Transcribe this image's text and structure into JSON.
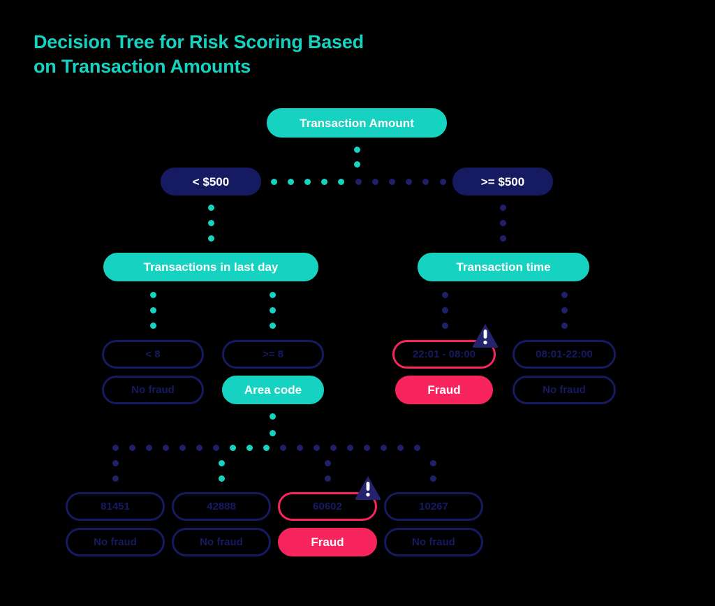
{
  "title": {
    "line1": "Decision Tree for Risk Scoring Based",
    "line2": "on Transaction Amounts"
  },
  "colors": {
    "background": "#000000",
    "teal": "#16d2c0",
    "navy": "#161a60",
    "pink": "#f8245e",
    "white": "#ffffff",
    "dot_navy": "#20206a"
  },
  "nodes": {
    "root": "Transaction Amount",
    "branch_low": "< $500",
    "branch_high": ">= $500",
    "left_feature": "Transactions in last day",
    "right_feature": "Transaction time",
    "left_count_low": "< 8",
    "left_count_high": ">= 8",
    "left_leaf_no_fraud": "No fraud",
    "area_code": "Area code",
    "time_night": "22:01 - 08:00",
    "time_day": "08:01-22:00",
    "time_night_leaf": "Fraud",
    "time_day_leaf": "No fraud",
    "zip_1": "81451",
    "zip_2": "42888",
    "zip_3": "60602",
    "zip_4": "10267",
    "zip_1_leaf": "No fraud",
    "zip_2_leaf": "No fraud",
    "zip_3_leaf": "Fraud",
    "zip_4_leaf": "No fraud"
  },
  "icons": {
    "alert_time": "alert-triangle-icon",
    "alert_zip": "alert-triangle-icon"
  }
}
